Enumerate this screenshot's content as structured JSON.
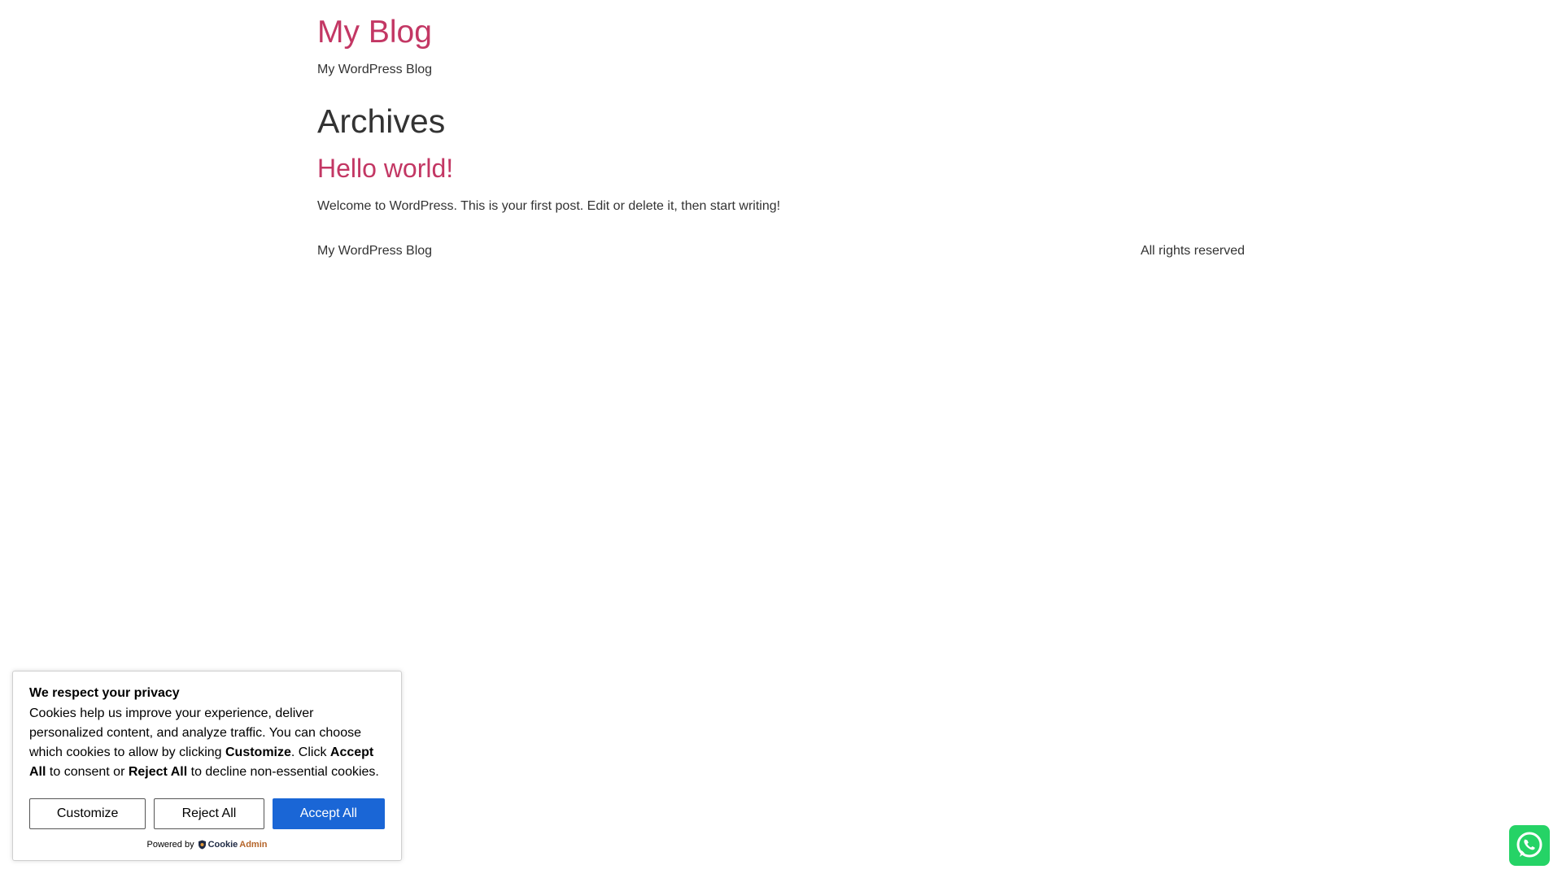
{
  "site": {
    "title": "My Blog",
    "tagline": "My WordPress Blog"
  },
  "archive": {
    "heading": "Archives",
    "posts": [
      {
        "title": "Hello world!",
        "excerpt": "Welcome to WordPress. This is your first post. Edit or delete it, then start writing!"
      }
    ]
  },
  "footer": {
    "left": "My WordPress Blog",
    "right": "All rights reserved"
  },
  "cookie_banner": {
    "heading": "We respect your privacy",
    "text_1": "Cookies help us improve your experience, deliver personalized content, and analyze traffic. You can choose which cookies to allow by clicking ",
    "bold_customize": "Customize",
    "text_2": ". Click ",
    "bold_accept": "Accept All",
    "text_3": " to consent or ",
    "bold_reject": "Reject All",
    "text_4": " to decline non-essential cookies.",
    "customize_label": "Customize",
    "reject_label": "Reject All",
    "accept_label": "Accept All",
    "powered_by": "Powered by",
    "brand_part1": "Cookie",
    "brand_part2": "Admin",
    "accept_color": "#1a66d6"
  },
  "whatsapp": {
    "icon": "whatsapp-icon",
    "color": "#25d366"
  },
  "colors": {
    "link": "#c33764",
    "text": "#333333"
  }
}
